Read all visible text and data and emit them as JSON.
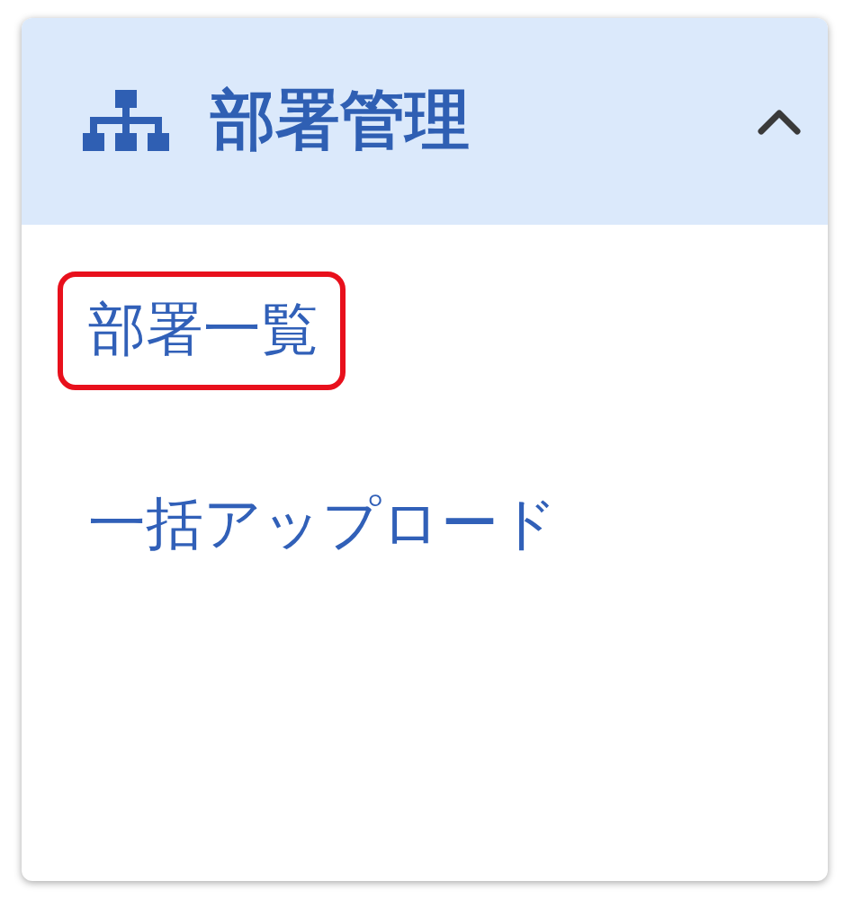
{
  "menu": {
    "title": "部署管理",
    "expanded": true,
    "items": [
      {
        "label": "部署一覧",
        "highlighted": true
      },
      {
        "label": "一括アップロード",
        "highlighted": false
      }
    ]
  }
}
